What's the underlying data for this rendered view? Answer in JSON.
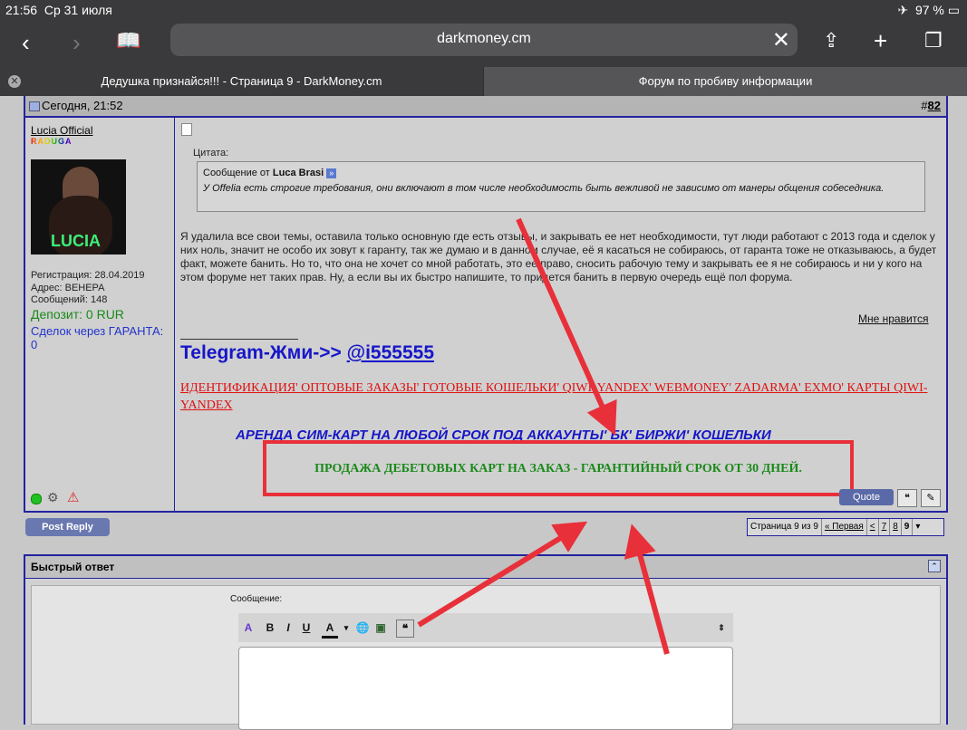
{
  "status": {
    "time": "21:56",
    "date": "Ср 31 июля",
    "battery": "97 %"
  },
  "browser": {
    "url": "darkmoney.cm",
    "tabs": [
      "Дедушка признайся!!! - Страница 9 - DarkMoney.cm",
      "Форум по пробиву информации"
    ],
    "icons": [
      "back-icon",
      "forward-icon",
      "bookmarks-icon",
      "share-icon",
      "new-tab-icon",
      "tabs-icon",
      "close-icon"
    ]
  },
  "post": {
    "date": "Сегодня, 21:52",
    "number_prefix": "#",
    "number": "82",
    "author": {
      "name": "Lucia Official",
      "rank": "RADUGA",
      "avatar_text": "LUCIA",
      "registration": "Регистрация: 28.04.2019",
      "address": "Адрес: ВЕНЕРА",
      "messages": "Сообщений: 148",
      "deposit": "Депозит: 0 RUR",
      "deals": "Сделок через ГАРАНТА: 0"
    },
    "quote": {
      "label": "Цитата:",
      "from_prefix": "Сообщение от",
      "from_user": "Luca Brasi",
      "text": "У Offelia есть строгие требования, они включают в том числе необходимость быть вежливой не зависимо от манеры общения собеседника."
    },
    "body": "Я удалила все свои темы, оставила только основную где есть отзывы, и закрывать ее нет необходимости, тут люди работают с 2013 года и сделок у них ноль, значит не особо их зовут к гаранту, так же думаю и в данном случае, её я касаться не собираюсь, от гаранта тоже не отказываюсь, а будет факт, можете банить. Но то, что она не хочет со мной работать, это ее право, сносить рабочую тему и закрывать ее я не собираюсь и ни у кого на этом форуме нет таких прав. Ну, а если вы их быстро напишите, то придется банить в первую очередь ещё пол форума.",
    "like": "Мне нравится",
    "signature": {
      "telegram_label": "Telegram-Жми->>",
      "telegram_handle": "@i555555",
      "ident": "ИДЕНТИФИКАЦИЯ' ОПТОВЫЕ ЗАКАЗЫ' ГОТОВЫЕ КОШЕЛЬКИ' QIWI' YANDEX' WEBMONEY' ZADARMA' EXMO' КАРТЫ QIWI-YANDEX",
      "rent": "АРЕНДА СИМ-КАРТ НА ЛЮБОЙ СРОК ПОД АККАУНТЫ' БК' БИРЖИ' КОШЕЛЬКИ",
      "debit": "ПРОДАЖА ДЕБЕТОВЫХ КАРТ НА ЗАКАЗ - ГАРАНТИЙНЫЙ СРОК ОТ 30 ДНЕЙ."
    },
    "quote_button": "Quote"
  },
  "post_reply": "Post Reply",
  "pager": {
    "label": "Страница 9 из 9",
    "first": "« Первая",
    "prev": "<",
    "p7": "7",
    "p8": "8",
    "p9": "9"
  },
  "quick_reply": {
    "title": "Быстрый ответ",
    "message_label": "Сообщение:"
  },
  "editor_buttons": {
    "bold": "B",
    "italic": "I",
    "underline": "U",
    "color": "A"
  },
  "colors": {
    "accent_red": "#e8303a",
    "forum_blue": "#2323a0",
    "green": "#1a8a1a"
  }
}
